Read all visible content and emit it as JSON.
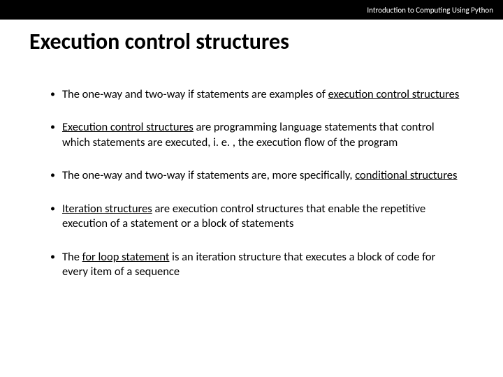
{
  "header": {
    "course": "Introduction to Computing Using Python"
  },
  "title": "Execution control structures",
  "bullets": [
    {
      "pre": "The one-way and two-way if statements are examples of ",
      "u": "execution control structures",
      "post": ""
    },
    {
      "pre": "",
      "u": "Execution control structures",
      "post": " are programming language statements that control which statements are executed, i. e. , the execution flow of the program"
    },
    {
      "pre": "The one-way and two-way if statements are, more specifically, ",
      "u": "conditional structures",
      "post": ""
    },
    {
      "pre": "",
      "u": "Iteration structures",
      "post": " are execution control structures that enable the repetitive execution of a statement or a block of statements"
    },
    {
      "pre": "The ",
      "u": "for loop statement",
      "post": " is an iteration structure that executes a block of code for every item of a sequence"
    }
  ]
}
